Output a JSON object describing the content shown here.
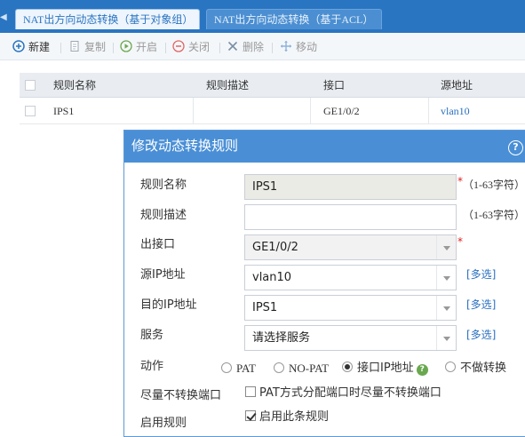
{
  "tabs": [
    {
      "label": "NAT出方向动态转换（基于对象组）",
      "active": true
    },
    {
      "label": "NAT出方向动态转换（基于ACL）",
      "active": false
    }
  ],
  "toolbar": {
    "new": "新建",
    "copy": "复制",
    "enable": "开启",
    "disable": "关闭",
    "delete": "删除",
    "move": "移动"
  },
  "table": {
    "columns": [
      "规则名称",
      "规则描述",
      "接口",
      "源地址"
    ],
    "rows": [
      {
        "name": "IPS1",
        "desc": "",
        "interface": "GE1/0/2",
        "source": "vlan10"
      }
    ]
  },
  "dialog": {
    "title": "修改动态转换规则",
    "help": "?",
    "fields": {
      "rule_name": {
        "label": "规则名称",
        "value": "IPS1",
        "hint": "（1-63字符）"
      },
      "rule_desc": {
        "label": "规则描述",
        "value": "",
        "hint": "（1-63字符）"
      },
      "out_interface": {
        "label": "出接口",
        "value": "GE1/0/2"
      },
      "source_ip": {
        "label": "源IP地址",
        "value": "vlan10",
        "link": "[多选]"
      },
      "dest_ip": {
        "label": "目的IP地址",
        "value": "IPS1",
        "link": "[多选]"
      },
      "service": {
        "label": "服务",
        "value": "请选择服务",
        "link": "[多选]"
      }
    },
    "action": {
      "label": "动作",
      "options": [
        "PAT",
        "NO-PAT",
        "接口IP地址",
        "不做转换"
      ],
      "selected": "接口IP地址"
    },
    "no_port_translate": {
      "label": "尽量不转换端口",
      "checkbox_label": "PAT方式分配端口时尽量不转换端口",
      "checked": false
    },
    "enable_rule": {
      "label": "启用规则",
      "checkbox_label": "启用此条规则",
      "checked": true
    },
    "required_mark": "*"
  },
  "colors": {
    "header": "#2a75c1",
    "dialog_header": "#4a8fd6",
    "link": "#2a6fc0"
  }
}
